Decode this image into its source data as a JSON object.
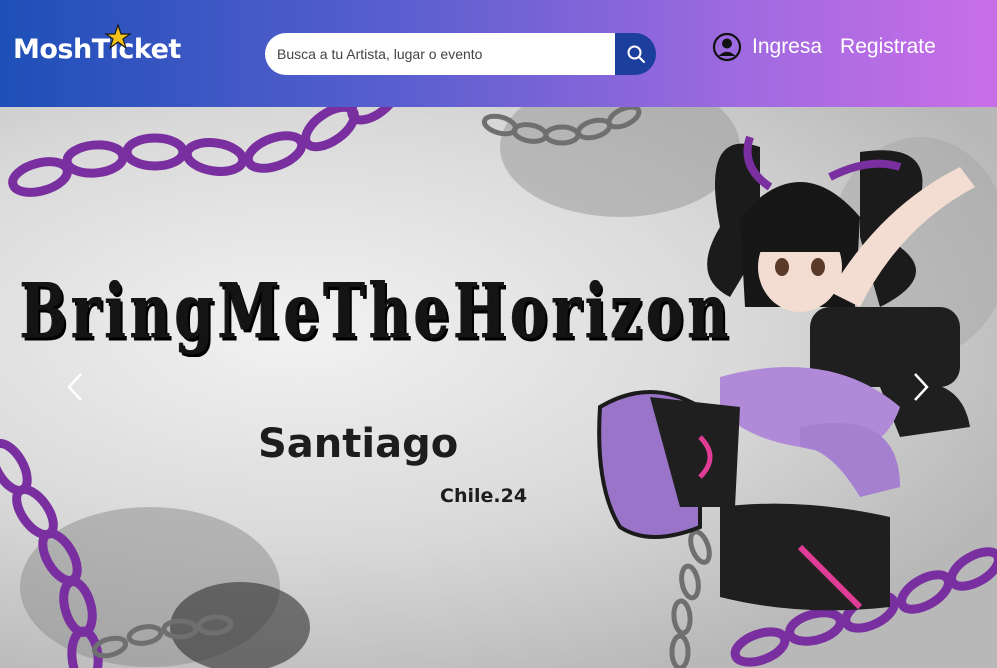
{
  "header": {
    "brand": "MoshTicket",
    "search": {
      "placeholder": "Busca a tu Artista, lugar o evento",
      "value": ""
    },
    "auth": {
      "login_label": "Ingresa",
      "register_label": "Registrate"
    },
    "colors": {
      "gradient_start": "#1e4fb8",
      "gradient_end": "#c96ee8",
      "search_button": "#1c3f9e",
      "star": "#f4c21a"
    }
  },
  "hero": {
    "gothic_title": [
      "Bring",
      "Me",
      "The",
      "Horizon"
    ],
    "city": "Santiago",
    "edition": "Chile.24",
    "prev_icon": "chevron-left-icon",
    "next_icon": "chevron-right-icon",
    "colors": {
      "chain": "#7a2fa0",
      "text": "#1d1d1d"
    }
  }
}
